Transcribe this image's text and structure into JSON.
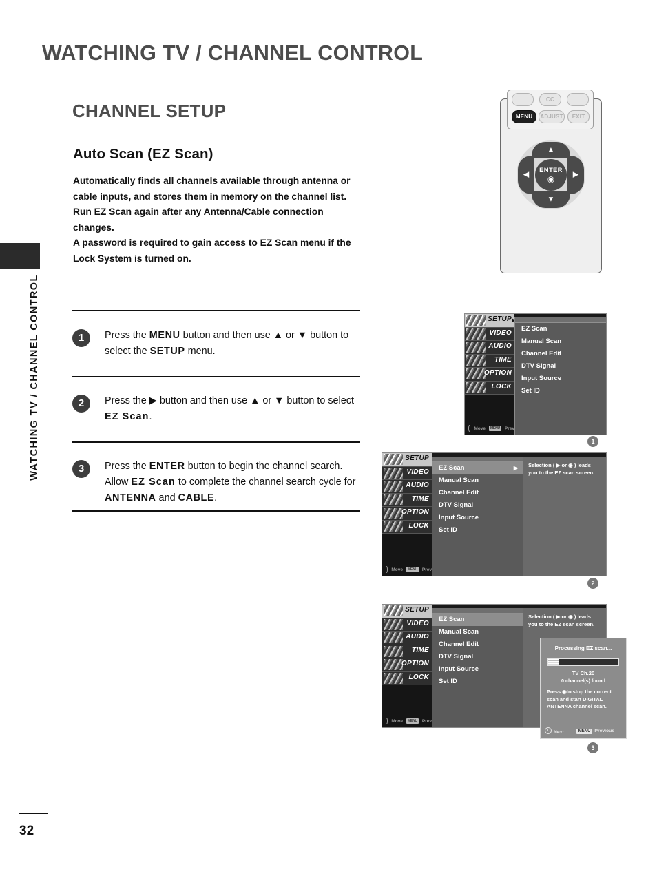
{
  "page": {
    "header_title": "WATCHING TV / CHANNEL CONTROL",
    "side_label": "WATCHING TV / CHANNEL CONTROL",
    "page_number": "32",
    "section_title": "CHANNEL SETUP",
    "sub_title": "Auto Scan (EZ Scan)"
  },
  "intro": {
    "p1": "Automatically finds all channels available through antenna or cable inputs, and stores them in memory on the channel list.",
    "p2": "Run EZ Scan again after any Antenna/Cable connection changes.",
    "p3": "A password is required to gain access to EZ Scan menu if the Lock System is turned on."
  },
  "steps": [
    {
      "number": "1",
      "html": "Press the <b>MENU</b> button and then use ▲ or ▼ button to select the <b>SETUP</b> menu."
    },
    {
      "number": "2",
      "html": "Press the ▶ button and then use ▲ or ▼ button to select <span class=\"mono\">EZ Scan</span>."
    },
    {
      "number": "3",
      "html": "Press the <b>ENTER</b> button to begin the channel search. Allow <span class=\"mono\">EZ Scan</span> to complete the channel search cycle for <b>ANTENNA</b> and <b>CABLE</b>."
    }
  ],
  "remote": {
    "top_row": [
      "",
      "CC",
      ""
    ],
    "second_row": [
      "MENU",
      "ADJUST",
      "EXIT"
    ],
    "enter_label": "ENTER",
    "dpad": {
      "up": "▲",
      "down": "▼",
      "left": "◀",
      "right": "▶"
    }
  },
  "osd": {
    "sidebar": [
      {
        "label": "SETUP"
      },
      {
        "label": "VIDEO"
      },
      {
        "label": "AUDIO"
      },
      {
        "label": "TIME"
      },
      {
        "label": "OPTION"
      },
      {
        "label": "LOCK"
      }
    ],
    "footer_move": "Move",
    "footer_prev": "Prev",
    "footer_prev_key": "MENU",
    "menu_items": [
      "EZ Scan",
      "Manual Scan",
      "Channel Edit",
      "DTV Signal",
      "Input Source",
      "Set ID"
    ],
    "help_text": "Selection ( ▶ or ◉ ) leads you to the EZ scan screen.",
    "selected_arrow": "▶"
  },
  "dialog": {
    "title": "Processing EZ scan...",
    "progress_percent": 16,
    "channel": "TV Ch.20",
    "found": "0 channel(s) found",
    "message": "Press ◉to stop the current scan and start DIGITAL ANTENNA channel scan.",
    "footer_next": "Next",
    "footer_prev_key": "MENU",
    "footer_prev": "Previous"
  },
  "figure_badges": [
    "1",
    "2",
    "3"
  ],
  "colors": {
    "header_gray": "#4c4c4c",
    "body_black": "#111111",
    "osd_dark": "#3a3a3a",
    "osd_mid": "#5a5a5a",
    "osd_light": "#8e8e8e",
    "dialog_bg": "#8c8c8c",
    "badge_gray": "#787878"
  }
}
